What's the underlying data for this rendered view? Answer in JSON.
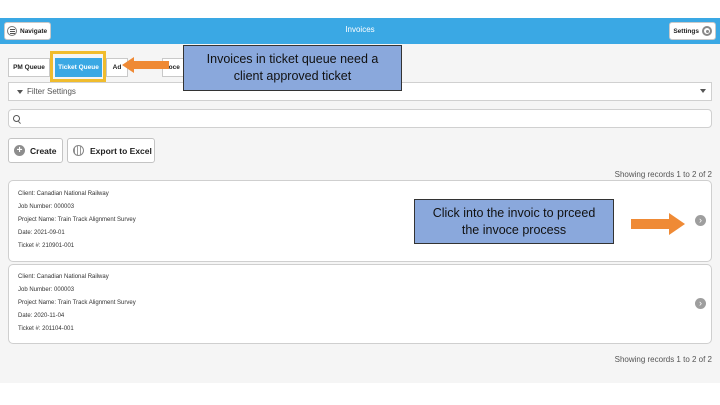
{
  "header": {
    "navigate_label": "Navigate",
    "title": "Invoices",
    "settings_label": "Settings"
  },
  "tabs": [
    {
      "label": "PM Queue"
    },
    {
      "label": "Ticket Queue",
      "active": true
    },
    {
      "label": "Ad"
    },
    {
      "label": "roce"
    }
  ],
  "filter": {
    "label": "Filter Settings"
  },
  "search": {
    "placeholder": ""
  },
  "actions": {
    "create_label": "Create",
    "export_label": "Export to Excel"
  },
  "records_text": "Showing records 1 to 2 of 2",
  "invoices": [
    {
      "client": "Client: Canadian National Railway",
      "job": "Job Number: 000003",
      "project": "Project Name: Train Track Alignment Survey",
      "date": "Date: 2021-09-01",
      "ticket": "Ticket #: 210901-001"
    },
    {
      "client": "Client: Canadian National Railway",
      "job": "Job Number: 000003",
      "project": "Project Name: Train Track Alignment Survey",
      "date": "Date: 2020-11-04",
      "ticket": "Ticket #: 201104-001"
    }
  ],
  "annotations": {
    "tab_note_line1": "Invoices in ticket queue need a",
    "tab_note_line2": "client approved ticket",
    "card_note_line1": "Click into the invoic to prceed",
    "card_note_line2": "the invoce process"
  },
  "colors": {
    "accent": "#3aa8e4",
    "highlight": "#f0bc2d",
    "callout": "#8aa8dc",
    "arrow": "#ef8a35"
  }
}
